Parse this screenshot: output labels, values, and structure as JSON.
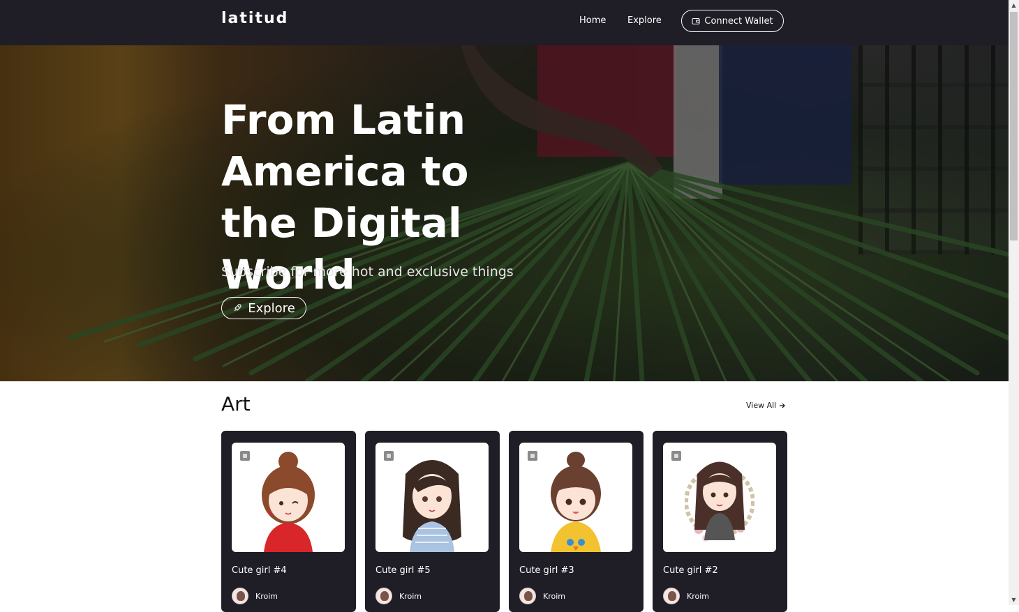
{
  "navbar": {
    "logo": "latitud",
    "links": [
      "Home",
      "Explore"
    ],
    "connect_wallet": "Connect Wallet"
  },
  "hero": {
    "title": "From Latin America to the Digital World",
    "subtitle": "Subscribe for more hot and exclusive things",
    "explore_button": "Explore"
  },
  "section": {
    "title": "Art",
    "view_all": "View All"
  },
  "cards": [
    {
      "name": "Cute girl #4",
      "owner": "Kroim",
      "hair_color": "#8b4a2b",
      "outfit_color": "#d8262a"
    },
    {
      "name": "Cute girl #5",
      "owner": "Kroim",
      "hair_color": "#3a2a22",
      "outfit_color": "#a9c3e0"
    },
    {
      "name": "Cute girl #3",
      "owner": "Kroim",
      "hair_color": "#6a4030",
      "outfit_color": "#f2c230"
    },
    {
      "name": "Cute girl #2",
      "owner": "Kroim",
      "hair_color": "#4a3028",
      "outfit_color": "#555555"
    }
  ],
  "icons": {
    "wallet": "wallet-icon",
    "rocket": "rocket-icon",
    "arrow": "arrow-right-icon",
    "image": "image-icon"
  },
  "colors": {
    "nav_bg": "#1f1d26",
    "card_bg": "#1f1d26",
    "text_light": "#ffffff"
  }
}
